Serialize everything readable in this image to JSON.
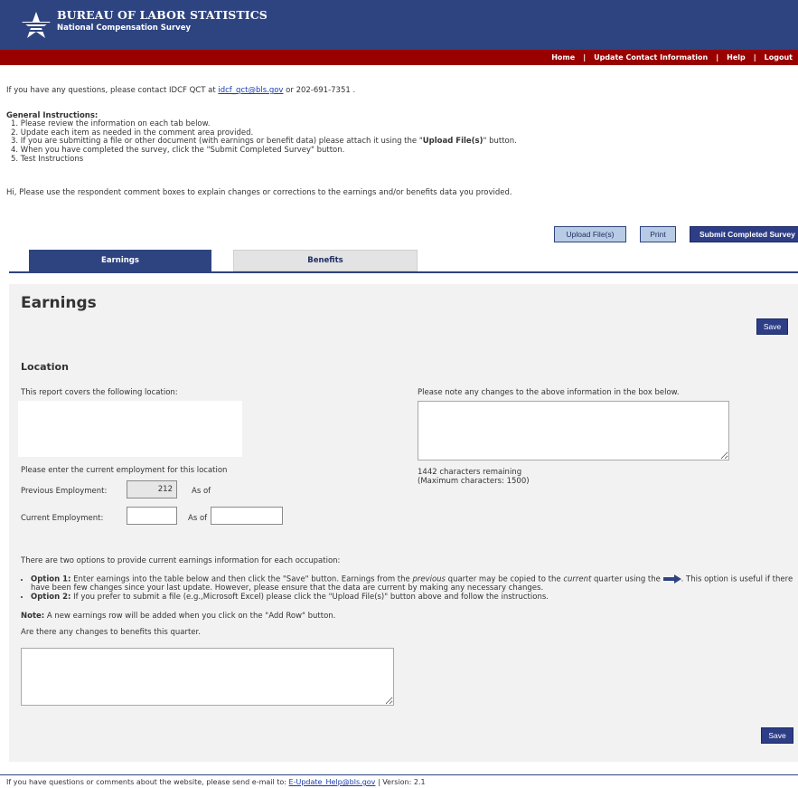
{
  "header": {
    "title": "BUREAU OF LABOR STATISTICS",
    "subtitle": "National Compensation Survey",
    "colors": {
      "header_bg": "#2e4480",
      "redbar": "#990000"
    }
  },
  "topnav": {
    "home": "Home",
    "update_contact": "Update Contact Information",
    "help": "Help",
    "logout": "Logout",
    "separator": "|"
  },
  "contact": {
    "prefix": "If you have any questions, please contact IDCF QCT at",
    "email": "idcf_qct@bls.gov",
    "suffix": "or 202-691-7351 ."
  },
  "general_instructions": {
    "title": "General Instructions:",
    "items": [
      "1. Please review the information on each tab below.",
      "2. Update each item as needed in the comment area provided.",
      "3. If you are submitting a file or other document (with earnings or benefit data) please attach it using the \"",
      "4. When you have completed the survey, click the \"Submit Completed Survey\" button.",
      "5. Test Instructions"
    ],
    "item3_bold": "Upload File(s)",
    "item3_end": "\" button."
  },
  "hi_text": "Hi, Please use the respondent comment boxes to explain changes or corrections to the earnings and/or benefits data you provided.",
  "actions": {
    "upload": "Upload File(s)",
    "print": "Print",
    "submit": "Submit Completed Survey"
  },
  "tabs": [
    {
      "label": "Earnings",
      "active": true
    },
    {
      "label": "Benefits",
      "active": false
    }
  ],
  "earnings": {
    "heading": "Earnings",
    "save": "Save",
    "location_heading": "Location",
    "covers_label": "This report covers the following location:",
    "note_label": "Please note any changes to the above information in the box below.",
    "chars_remaining": "1442 characters remaining",
    "max_chars": "(Maximum characters: 1500)",
    "enter_employment": "Please enter the current employment for this location",
    "prev_emp_label": "Previous Employment:",
    "prev_emp_value": "212",
    "as_of": "As of",
    "curr_emp_label": "Current Employment:",
    "two_options": "There are two options to provide current earnings information for each occupation:",
    "option1_label": "Option 1:",
    "option1_a": " Enter earnings into the table below and then click the \"Save\" button. Earnings from the ",
    "option1_prev": "previous",
    "option1_b": " quarter may be copied to the ",
    "option1_curr": "current",
    "option1_c": " quarter using the ",
    "option1_d": ". This option is useful if there have been few changes since your last update. However, please ensure that the data are current by making any necessary changes.",
    "option2_label": "Option 2:",
    "option2_text": " If you prefer to submit a file (e.g.,Microsoft Excel) please click the \"Upload File(s)\" button above and follow the instructions.",
    "note_label_bold": "Note:",
    "note_text": " A new earnings row will be added when you click on the \"Add Row\" button.",
    "benefits_q": "Are there any changes to benefits this quarter."
  },
  "footer": {
    "prefix": "If you have questions or comments about the website, please send e-mail to:",
    "email": "E-Update_Help@bls.gov",
    "version": "| Version: 2.1"
  }
}
